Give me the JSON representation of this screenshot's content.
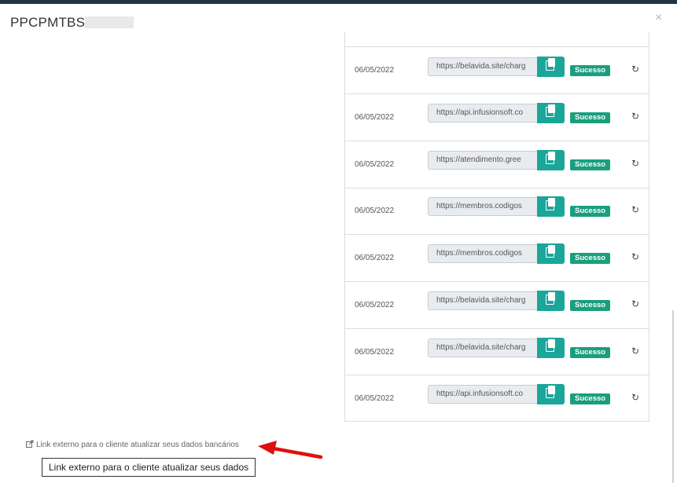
{
  "modal": {
    "title": "PPCPMTBS",
    "close_icon": "×"
  },
  "rows": [
    {
      "date": "06/05/2022",
      "url": "https://belavida.site/charg",
      "status": "Sucesso"
    },
    {
      "date": "06/05/2022",
      "url": "https://api.infusionsoft.co",
      "status": "Sucesso"
    },
    {
      "date": "06/05/2022",
      "url": "https://atendimento.gree",
      "status": "Sucesso"
    },
    {
      "date": "06/05/2022",
      "url": "https://membros.codigos",
      "status": "Sucesso"
    },
    {
      "date": "06/05/2022",
      "url": "https://membros.codigos",
      "status": "Sucesso"
    },
    {
      "date": "06/05/2022",
      "url": "https://belavida.site/charg",
      "status": "Sucesso"
    },
    {
      "date": "06/05/2022",
      "url": "https://belavida.site/charg",
      "status": "Sucesso"
    },
    {
      "date": "06/05/2022",
      "url": "https://api.infusionsoft.co",
      "status": "Sucesso"
    }
  ],
  "external_link": {
    "label": "Link externo para o cliente atualizar seus dados bancários"
  },
  "tooltip": {
    "text": "Link externo para o cliente atualizar seus dados"
  },
  "colors": {
    "accent": "#1aa699",
    "success": "#1a9e7e",
    "arrow": "#e01010"
  }
}
